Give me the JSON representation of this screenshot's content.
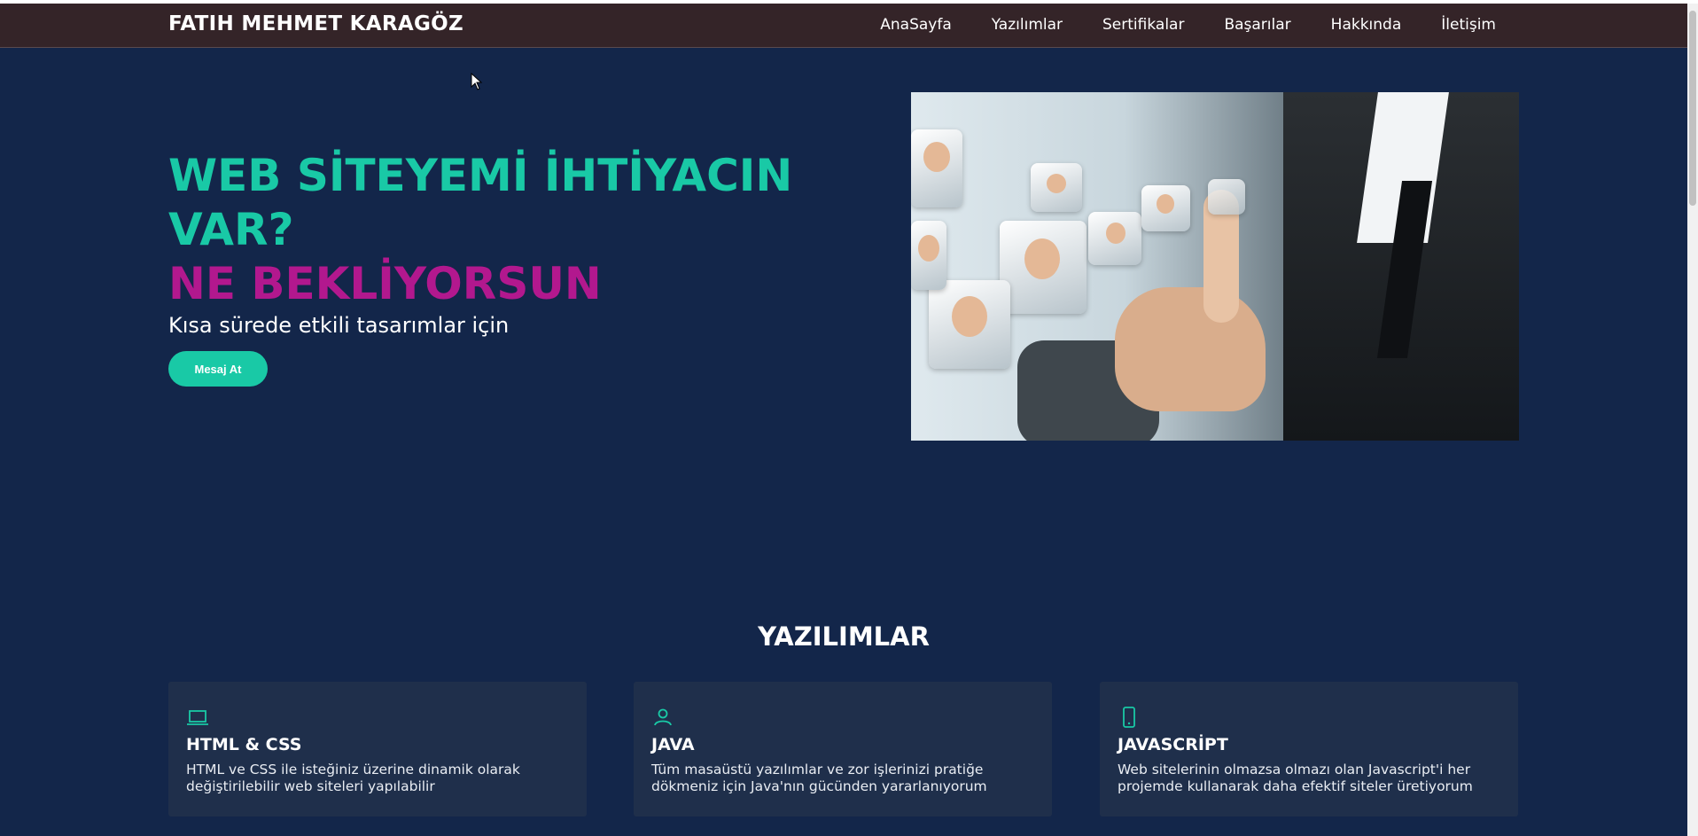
{
  "header": {
    "brand": "FATIH MEHMET KARAGÖZ",
    "nav": [
      "AnaSayfa",
      "Yazılımlar",
      "Sertifikalar",
      "Başarılar",
      "Hakkında",
      "İletişim"
    ]
  },
  "hero": {
    "title_line1": "WEB SİTEYEMİ İHTİYACIN VAR?",
    "title_line2": "NE BEKLİYORSUN",
    "subtitle": "Kısa sürede etkili tasarımlar için",
    "button_label": "Mesaj At"
  },
  "services": {
    "title": "YAZILIMLAR",
    "cards": [
      {
        "icon": "laptop-icon",
        "title": "HTML & CSS",
        "text": "HTML ve CSS ile isteğiniz üzerine dinamik olarak değiştirilebilir web siteleri yapılabilir"
      },
      {
        "icon": "user-icon",
        "title": "JAVA",
        "text": "Tüm masaüstü yazılımlar ve zor işlerinizi pratiğe dökmeniz için Java'nın gücünden yararlanıyorum"
      },
      {
        "icon": "smartphone-icon",
        "title": "JAVASCRİPT",
        "text": "Web sitelerinin olmazsa olmazı olan Javascript'i her projemde kullanarak daha efektif siteler üretiyorum"
      }
    ]
  },
  "colors": {
    "background": "#13264a",
    "navbar": "#342428",
    "accent_teal": "#19c9a6",
    "accent_magenta": "#b2188e",
    "card": "#1f2f4b"
  }
}
